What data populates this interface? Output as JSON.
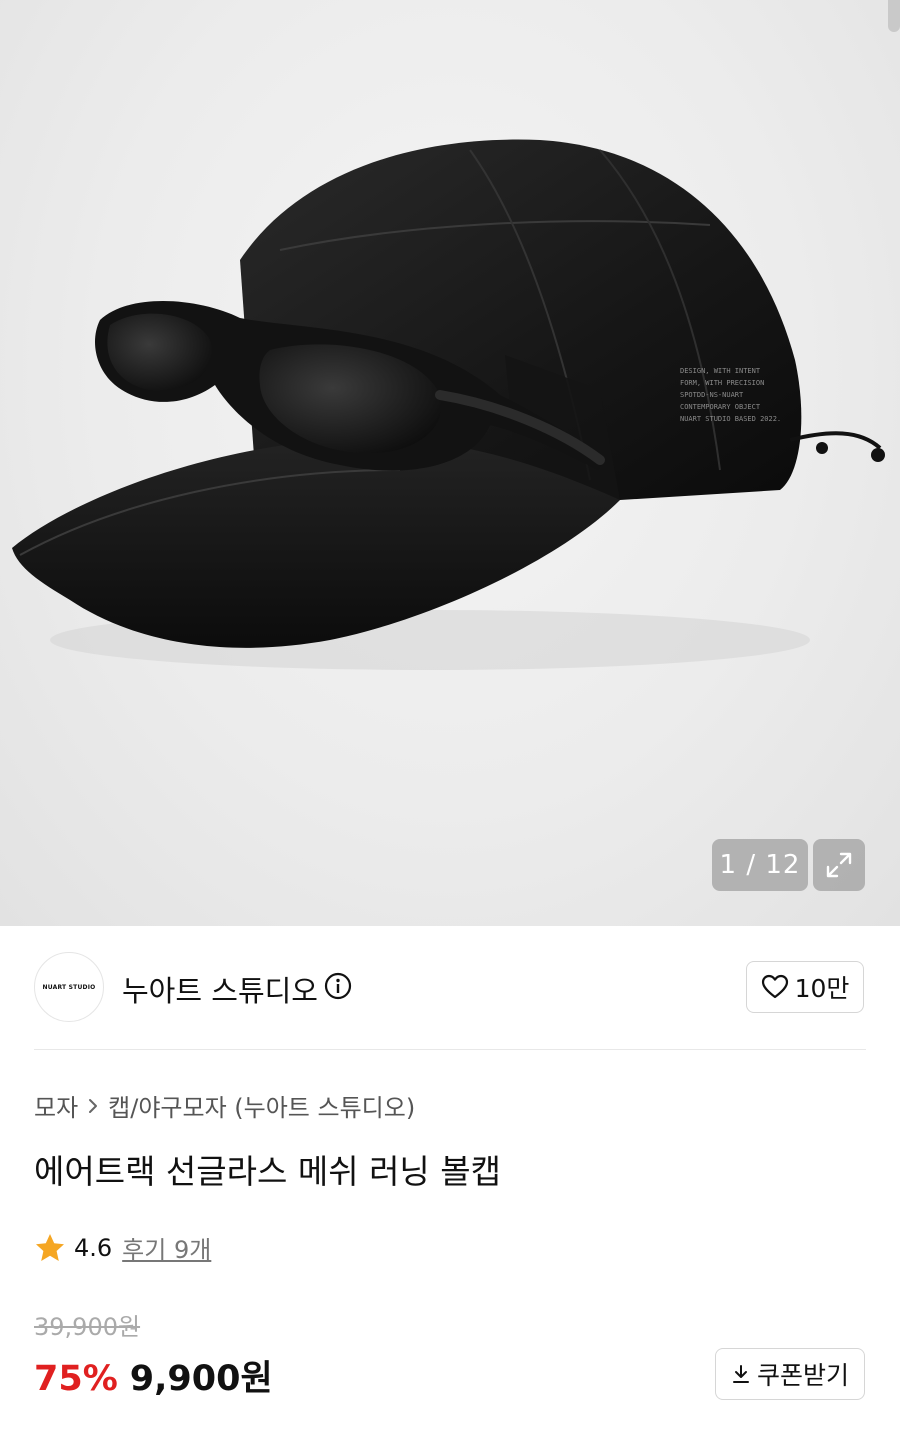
{
  "gallery": {
    "current": "1",
    "total": "12",
    "counter_text": "1 / 12",
    "cap_print": [
      "DESIGN, WITH INTENT",
      "FORM, WITH PRECISION",
      "SPOTDD-NS-NUART",
      "CONTEMPORARY OBJECT",
      "NUART STUDIO BASED 2022."
    ]
  },
  "brand": {
    "logo_text": "NUART STUDIO",
    "name": "누아트 스튜디오",
    "like_count": "10만",
    "icons": {
      "info": "info-icon",
      "like": "heart-icon"
    }
  },
  "product": {
    "breadcrumb": [
      "모자",
      "캡/야구모자 (누아트 스튜디오)"
    ],
    "title": "에어트랙 선글라스 메쉬 러닝 볼캡",
    "rating": "4.6",
    "review_label": "후기 9개",
    "original_price": "39,900원",
    "discount": "75%",
    "sale_price": "9,900원",
    "coupon_label": "쿠폰받기"
  },
  "colors": {
    "discount": "#e02020",
    "star": "#f5a623",
    "accent_text": "#111111"
  }
}
